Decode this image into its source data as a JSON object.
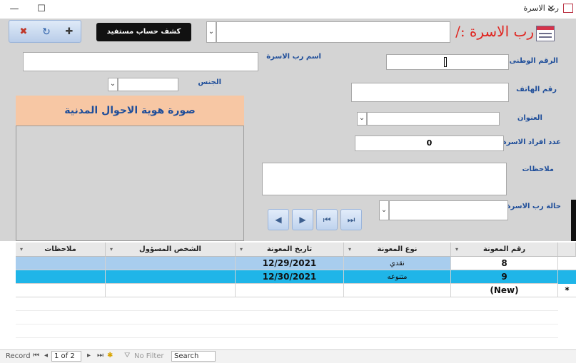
{
  "window": {
    "title": "رب الاسرة",
    "minimize_glyph": "—",
    "maximize_glyph": "☐",
    "close_glyph": "✕"
  },
  "header": {
    "form_title": "رب الاسرة :/",
    "report_button": "كشف حساب مستفيد",
    "lookup_combo_value": ""
  },
  "toolbar": {
    "icons": [
      "delete-record-icon",
      "undo-icon",
      "new-record-icon"
    ]
  },
  "fields": {
    "national_id": {
      "label": "الرقم الوطنى",
      "value": ""
    },
    "head_name": {
      "label": "اسم رب الاسرة",
      "value": ""
    },
    "phone": {
      "label": "رقم الهاتف",
      "value": ""
    },
    "gender": {
      "label": "الجنس",
      "value": ""
    },
    "address": {
      "label": "العنوان",
      "value": ""
    },
    "family_count": {
      "label": "عدد افراد الاسرة",
      "value": "0"
    },
    "notes": {
      "label": "ملاحظات",
      "value": ""
    },
    "status": {
      "label": "حالة رب الاسرة",
      "value": ""
    }
  },
  "id_photo": {
    "caption": "صورة هوية الاحوال المدنية"
  },
  "navigation": {
    "buttons": [
      "◀",
      "▶",
      "⏮",
      "⏭"
    ]
  },
  "datasheet": {
    "columns": [
      "رقم المعونة",
      "نوع المعونة",
      "تاريخ المعونة",
      "الشخص المسؤول",
      "ملاحظات"
    ],
    "rows": [
      {
        "aid_no": "8",
        "aid_type": "نقدي",
        "date": "12/29/2021",
        "responsible": "",
        "notes": ""
      },
      {
        "aid_no": "9",
        "aid_type": "متنوعه",
        "date": "12/30/2021",
        "responsible": "",
        "notes": ""
      }
    ],
    "new_row_label": "(New)",
    "new_row_marker": "*"
  },
  "record_nav": {
    "record_label": "Record",
    "position": "1 of 2",
    "filter_label": "No Filter",
    "search_label": "Search"
  },
  "colors": {
    "form_bg": "#d4d4d4",
    "title_red": "#e0241f",
    "label_blue": "#1f4e9a",
    "photo_header": "#f7c7a4",
    "row_selected": "#a8cdee",
    "row_current": "#1fb5e8"
  }
}
